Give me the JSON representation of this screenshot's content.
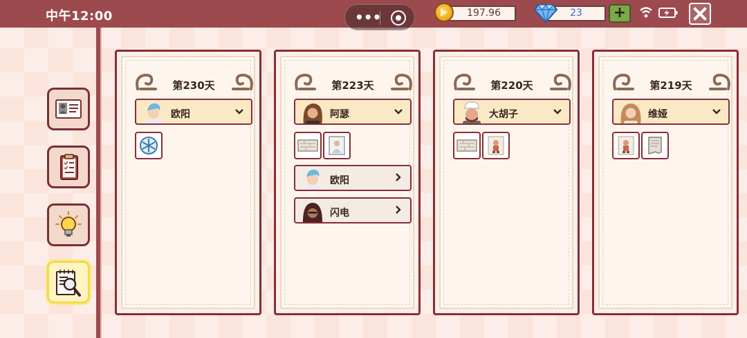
{
  "status_bar": {
    "time": "中午12:00",
    "capsule_more": "•••",
    "coins": "197.96",
    "gems": "23"
  },
  "sidebar": {
    "items": [
      {
        "name": "id-card",
        "icon": "id-card-icon"
      },
      {
        "name": "clipboard",
        "icon": "clipboard-icon"
      },
      {
        "name": "lightbulb",
        "icon": "lightbulb-icon"
      },
      {
        "name": "investigation",
        "icon": "magnifier-notebook-icon",
        "active": true
      }
    ]
  },
  "cards": [
    {
      "day": "第230天",
      "owner": {
        "name": "欧阳",
        "avatar": "blue-hair-man"
      },
      "items": [
        "snowflake-badge-icon"
      ],
      "friends": []
    },
    {
      "day": "第223天",
      "owner": {
        "name": "阿瑟",
        "avatar": "long-hair-man"
      },
      "items": [
        "wall-texture-icon",
        "portrait-photo-icon"
      ],
      "friends": [
        {
          "name": "欧阳",
          "avatar": "blue-hair-man"
        },
        {
          "name": "闪电",
          "avatar": "hooded-man"
        }
      ]
    },
    {
      "day": "第220天",
      "owner": {
        "name": "大胡子",
        "avatar": "chef-man"
      },
      "items": [
        "wall-texture-icon",
        "doll-figure-icon"
      ],
      "friends": []
    },
    {
      "day": "第219天",
      "owner": {
        "name": "维娅",
        "avatar": "curly-hair-woman"
      },
      "items": [
        "doll-figure-icon",
        "paper-scroll-icon"
      ],
      "friends": []
    }
  ],
  "colors": {
    "bar": "#9c4a4e",
    "card_border": "#8a2c37",
    "owner_bg": "#fbe8c4",
    "active_button": "#f5d94a"
  }
}
